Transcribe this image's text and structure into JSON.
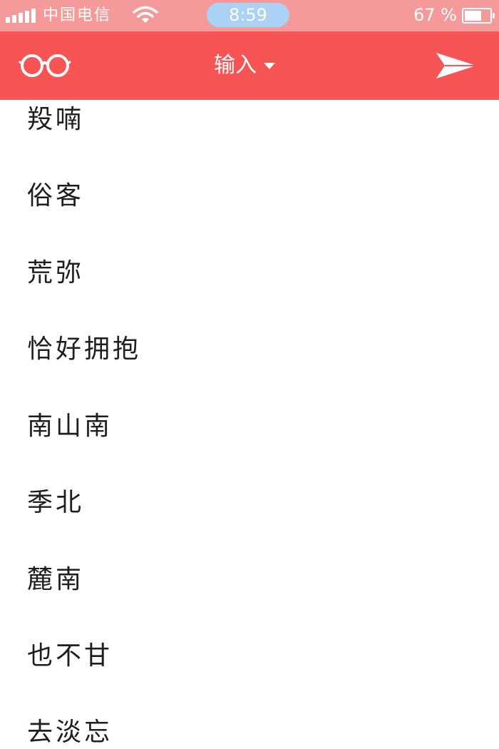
{
  "status_bar": {
    "carrier": "中国电信",
    "time": "8:59",
    "battery_percent": "67 %",
    "battery_level": 0.67
  },
  "nav": {
    "title": "输入",
    "left_icon": "glasses-icon",
    "right_icon": "send-icon",
    "accent_color": "#f65455"
  },
  "list": {
    "items": [
      {
        "label": "羖喃"
      },
      {
        "label": "俗客"
      },
      {
        "label": "荒弥"
      },
      {
        "label": "恰好拥抱"
      },
      {
        "label": "南山南"
      },
      {
        "label": "季北"
      },
      {
        "label": "麓南"
      },
      {
        "label": "也不甘"
      },
      {
        "label": "去淡忘"
      }
    ]
  }
}
